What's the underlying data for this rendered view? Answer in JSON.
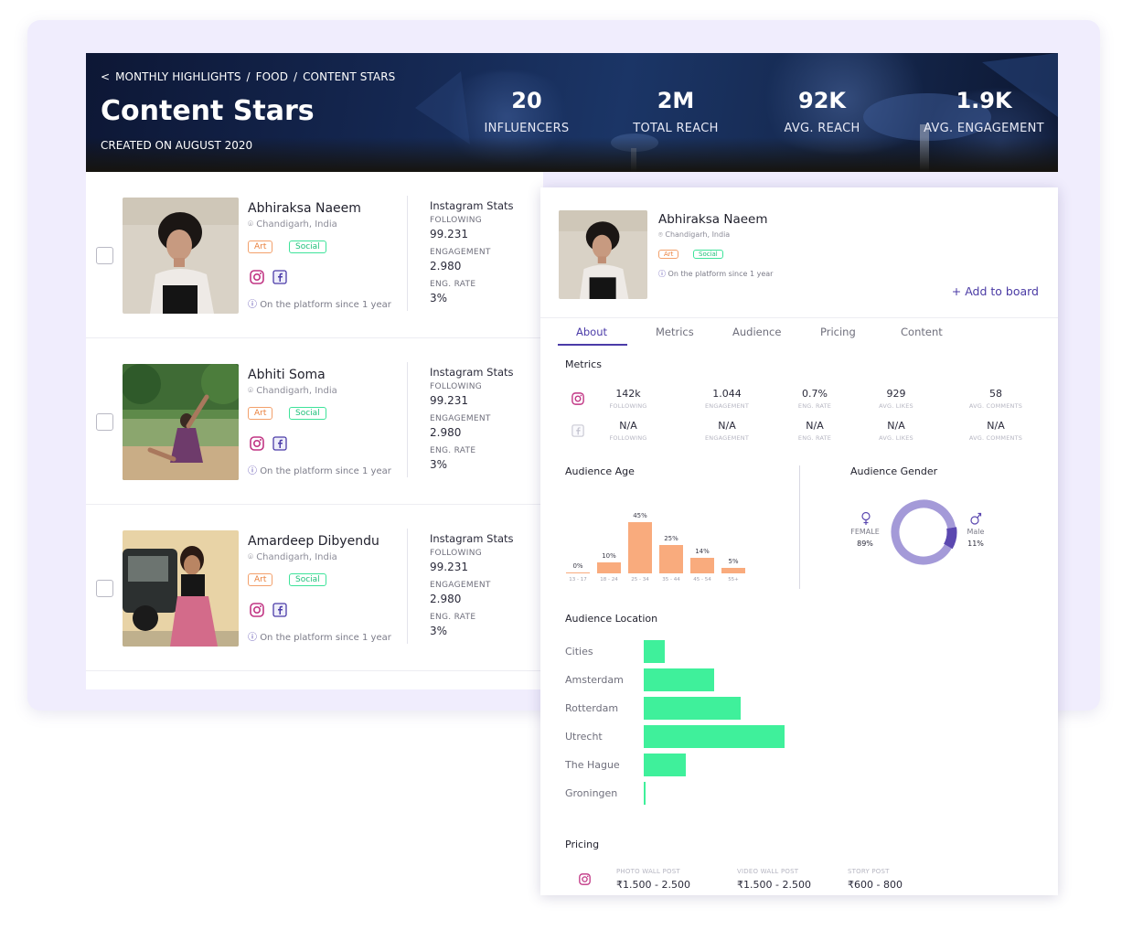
{
  "header": {
    "breadcrumb": [
      "MONTHLY HIGHLIGHTS",
      "/",
      "FOOD",
      "/",
      "CONTENT STARS"
    ],
    "back_arrow": "<",
    "title": "Content Stars",
    "created_on": "CREATED ON AUGUST 2020",
    "stats": [
      {
        "value": "20",
        "label": "INFLUENCERS"
      },
      {
        "value": "2M",
        "label": "TOTAL  REACH"
      },
      {
        "value": "92K",
        "label": "AVG. REACH"
      },
      {
        "value": "1.9K",
        "label": "AVG. ENGAGEMENT"
      }
    ]
  },
  "influencers": [
    {
      "name": "Abhiraksa Naeem",
      "location": "Chandigarh, India",
      "tags": [
        "Art",
        "Social"
      ],
      "since": "On the platform  since 1 year",
      "stats_title": "Instagram Stats",
      "following_label": "FOLLOWING",
      "following": "99.231",
      "engagement_label": "ENGAGEMENT",
      "engagement": "2.980",
      "rate_label": "ENG. RATE",
      "rate": "3%"
    },
    {
      "name": "Abhiti Soma",
      "location": "Chandigarh, India",
      "tags": [
        "Art",
        "Social"
      ],
      "since": "On the platform  since 1 year",
      "stats_title": "Instagram Stats",
      "following_label": "FOLLOWING",
      "following": "99.231",
      "engagement_label": "ENGAGEMENT",
      "engagement": "2.980",
      "rate_label": "ENG. RATE",
      "rate": "3%"
    },
    {
      "name": "Amardeep Dibyendu",
      "location": "Chandigarh, India",
      "tags": [
        "Art",
        "Social"
      ],
      "since": "On the platform  since 1 year",
      "stats_title": "Instagram Stats",
      "following_label": "FOLLOWING",
      "following": "99.231",
      "engagement_label": "ENGAGEMENT",
      "engagement": "2.980",
      "rate_label": "ENG. RATE",
      "rate": "3%"
    }
  ],
  "detail": {
    "name": "Abhiraksa Naeem",
    "location": "Chandigarh, India",
    "tags": [
      "Art",
      "Social"
    ],
    "since": "On the platform  since 1 year",
    "add_to_board": "+ Add to board",
    "tabs": [
      "About",
      "Metrics",
      "Audience",
      "Pricing",
      "Content"
    ],
    "active_tab": "About",
    "metrics_title": "Metrics",
    "metrics": {
      "instagram": [
        {
          "value": "142k",
          "label": "FOLLOWING"
        },
        {
          "value": "1.044",
          "label": "ENGAGEMENT"
        },
        {
          "value": "0.7%",
          "label": "ENG. RATE"
        },
        {
          "value": "929",
          "label": "AVG. LIKES"
        },
        {
          "value": "58",
          "label": "AVG. COMMENTS"
        }
      ],
      "facebook": [
        {
          "value": "N/A",
          "label": "FOLLOWING"
        },
        {
          "value": "N/A",
          "label": "ENGAGEMENT"
        },
        {
          "value": "N/A",
          "label": "ENG. RATE"
        },
        {
          "value": "N/A",
          "label": "AVG. LIKES"
        },
        {
          "value": "N/A",
          "label": "AVG. COMMENTS"
        }
      ]
    },
    "audience_age_title": "Audience Age",
    "audience_gender_title": "Audience Gender",
    "gender": {
      "female_label": "FEMALE",
      "female_value": "89%",
      "male_label": "Male",
      "male_value": "11%"
    },
    "audience_location_title": "Audience Location",
    "pricing_title": "Pricing",
    "pricing": [
      {
        "label": "PHOTO WALL POST",
        "value": "₹1.500 - 2.500"
      },
      {
        "label": "VIDEO WALL POST",
        "value": "₹1.500 - 2.500"
      },
      {
        "label": "STORY POST",
        "value": "₹600 - 800"
      }
    ]
  },
  "chart_data": [
    {
      "type": "bar",
      "title": "Audience Age",
      "categories": [
        "13 - 17",
        "18 - 24",
        "25 - 34",
        "35 - 44",
        "45 - 54",
        "55+"
      ],
      "values": [
        0,
        10,
        45,
        25,
        14,
        5
      ],
      "value_labels": [
        "0%",
        "10%",
        "45%",
        "25%",
        "14%",
        "5%"
      ],
      "ylim": [
        0,
        50
      ],
      "color": "#f9ab7d"
    },
    {
      "type": "pie",
      "title": "Audience Gender",
      "categories": [
        "FEMALE",
        "Male"
      ],
      "values": [
        89,
        11
      ],
      "colors": [
        "#a49ad8",
        "#5b48b0"
      ]
    },
    {
      "type": "bar",
      "orientation": "horizontal",
      "title": "Audience Location",
      "categories": [
        "Cities",
        "Amsterdam",
        "Rotterdam",
        "Utrecht",
        "The Hague",
        "Groningen"
      ],
      "values": [
        15,
        50,
        69,
        100,
        30,
        1
      ],
      "color": "#3ff09b"
    }
  ],
  "colors": {
    "accent": "#4b3ba8",
    "tag_art": "#e97f3b",
    "tag_social": "#1fc07a",
    "panel_bg": "#f0edfd"
  }
}
